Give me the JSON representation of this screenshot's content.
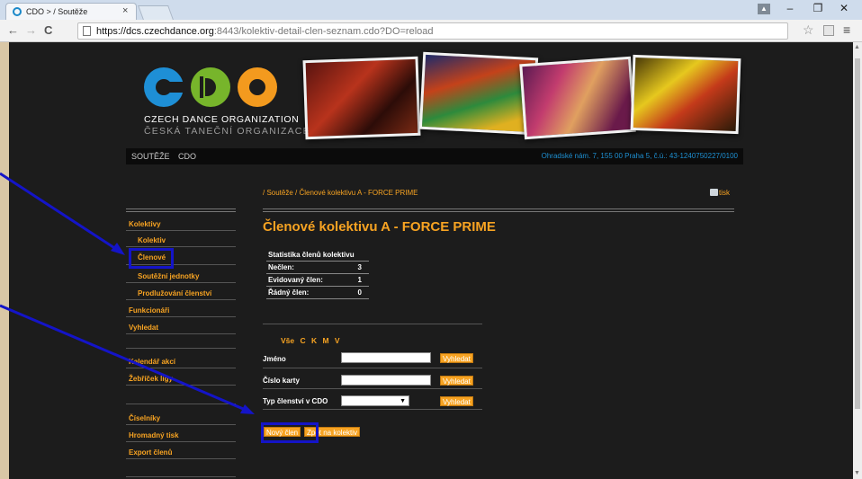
{
  "browser": {
    "tab_title": "CDO > / Soutěže",
    "tab_close": "×",
    "url_host": "https://dcs.czechdance.org",
    "url_rest": ":8443/kolektiv-detail-clen-seznam.cdo?DO=reload",
    "back": "←",
    "forward": "→",
    "reload": "C",
    "star": "☆",
    "menu": "≡",
    "minimize": "–",
    "maximize": "❐",
    "close": "✕",
    "user": "▲"
  },
  "header": {
    "logo_line1": "CZECH DANCE ORGANIZATION",
    "logo_line2": "ČESKÁ TANEČNÍ ORGANIZACE",
    "menu": [
      "SOUTĚŽE",
      "CDO"
    ],
    "address": "Ohradské nám. 7, 155 00 Praha 5, č.ú.: 43-1240750227/0100"
  },
  "breadcrumb": "/ Soutěže / Členové kolektivu A - FORCE PRIME",
  "print_label": "tisk",
  "page_title": "Členové kolektivu A - FORCE PRIME",
  "stats": {
    "heading": "Statistika členů kolektivu",
    "rows": [
      {
        "label": "Nečlen:",
        "value": "3"
      },
      {
        "label": "Evidovaný člen:",
        "value": "1"
      },
      {
        "label": "Řádný člen:",
        "value": "0"
      }
    ]
  },
  "letters": "Vše C K M V",
  "search": {
    "name_label": "Jméno",
    "card_label": "Číslo karty",
    "type_label": "Typ členství v CDO",
    "search_button": "Vyhledat"
  },
  "actions": {
    "new_member": "Nový člen",
    "back_to_collective": "Zpět na kolektiv"
  },
  "sidebar": {
    "items": [
      "Kolektivy",
      "Kolektiv",
      "Členové",
      "Soutěžní jednotky",
      "Prodlužování členství",
      "Funkcionáři",
      "Vyhledat",
      "Kalendář akcí",
      "Žebříček ligy",
      "Číselníky",
      "Hromadný tisk",
      "Export členů"
    ]
  },
  "colors": {
    "accent": "#f7a322",
    "page_bg": "#1c1c1c",
    "annotation": "#1414c8",
    "link_blue": "#1e90d2"
  }
}
